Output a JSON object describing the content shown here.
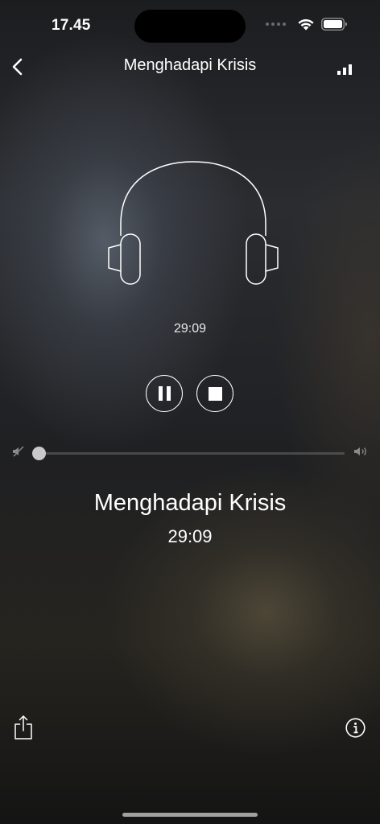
{
  "status_bar": {
    "time": "17.45"
  },
  "nav": {
    "title": "Menghadapi Krisis",
    "back_icon": "chevron-left-icon",
    "signal_icon": "signal-bars-icon"
  },
  "player": {
    "artwork_icon": "headphones-icon",
    "elapsed": "29:09",
    "pause_icon": "pause-icon",
    "stop_icon": "stop-icon",
    "volume_level": 0,
    "volume_low_icon": "volume-mute-icon",
    "volume_high_icon": "volume-high-icon"
  },
  "now_playing": {
    "title": "Menghadapi Krisis",
    "time": "29:09"
  },
  "bottom_bar": {
    "share_icon": "share-icon",
    "info_icon": "info-icon"
  }
}
